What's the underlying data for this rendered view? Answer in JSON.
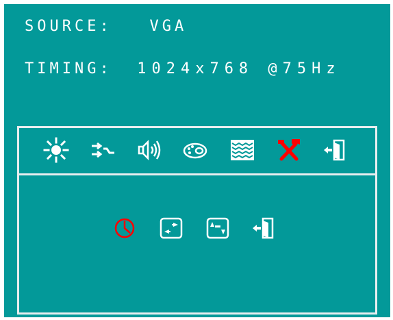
{
  "info": {
    "source_label": "SOURCE:",
    "source_value": "VGA",
    "timing_label": "TIMING:",
    "timing_value": "1024x768 @75Hz"
  },
  "main_menu": {
    "icons": [
      "brightness-icon",
      "input-source-icon",
      "audio-icon",
      "color-palette-icon",
      "image-setup-icon",
      "tools-icon",
      "exit-icon"
    ],
    "selected": "tools-icon",
    "selected_color": "#ff0000"
  },
  "sub_menu": {
    "icons": [
      "clock-icon",
      "horizontal-position-icon",
      "vertical-position-icon",
      "exit-icon"
    ],
    "selected": "clock-icon",
    "selected_color": "#ff0000"
  },
  "colors": {
    "background": "#039999",
    "foreground": "#ffffff"
  }
}
